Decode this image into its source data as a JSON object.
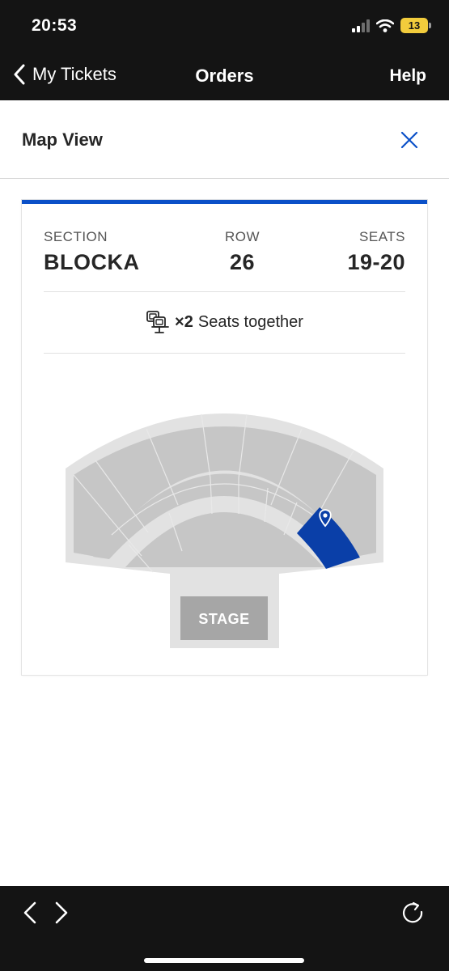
{
  "status_bar": {
    "time": "20:53",
    "battery": "13"
  },
  "nav": {
    "back_label": "My Tickets",
    "title": "Orders",
    "help_label": "Help"
  },
  "sheet": {
    "title": "Map View"
  },
  "ticket": {
    "section_label": "SECTION",
    "section_value": "BLOCKA",
    "row_label": "ROW",
    "row_value": "26",
    "seats_label": "SEATS",
    "seats_value": "19-20",
    "together_count": "×2",
    "together_text": "Seats together"
  },
  "seat_map": {
    "stage_label": "STAGE"
  },
  "colors": {
    "selected_section": "#0a3fa8",
    "accent": "#0a50c8",
    "bar_background": "#141414"
  }
}
